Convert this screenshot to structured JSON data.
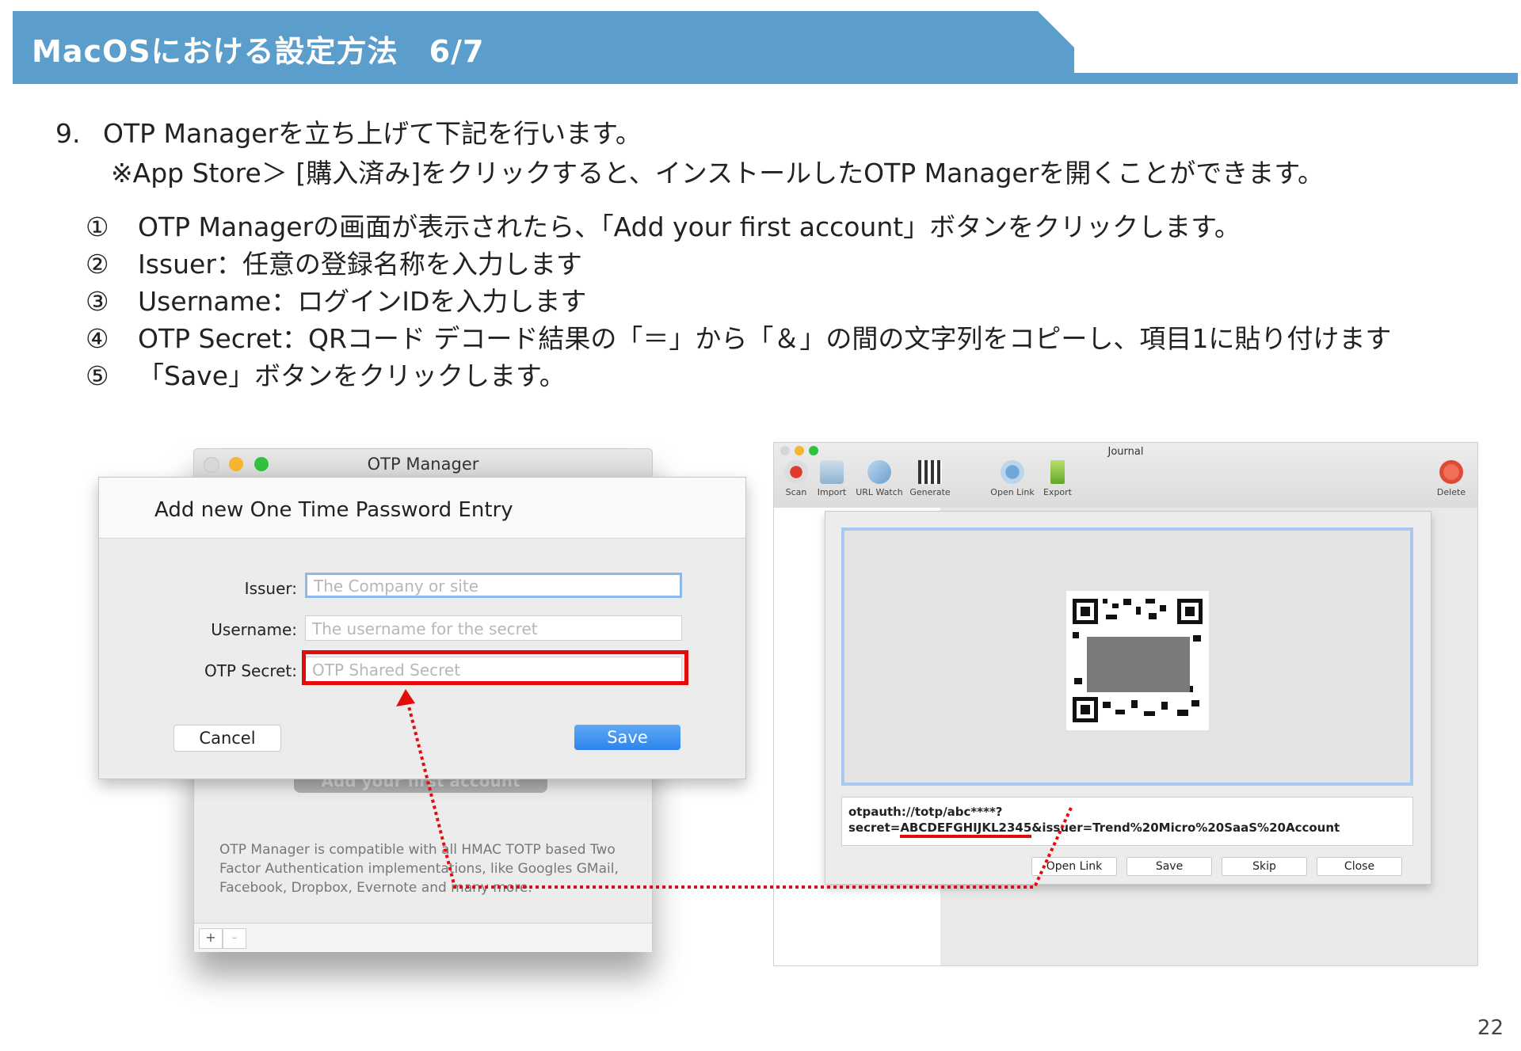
{
  "header": {
    "title": "MacOSにおける設定方法　6/7"
  },
  "intro": {
    "step_number": "9.",
    "step_text": "OTP Managerを立ち上げて下記を行います。",
    "note": "※App Store＞ [購入済み]をクリックすると、インストールしたOTP Managerを開くことができます。"
  },
  "instructions": [
    {
      "mark": "①",
      "text": "OTP Managerの画面が表示されたら、「Add your first account」ボタンをクリックします。"
    },
    {
      "mark": "②",
      "text": "Issuer：任意の登録名称を入力します"
    },
    {
      "mark": "③",
      "text": "Username：ログインIDを入力します"
    },
    {
      "mark": "④",
      "text": "OTP Secret：QRコード デコード結果の「＝」から「＆」の間の文字列をコピーし、項目1に貼り付けます"
    },
    {
      "mark": "⑤",
      "text": "「Save」ボタンをクリックします。"
    }
  ],
  "otp_window": {
    "title": "OTP Manager",
    "ghost_button": "Add your first account",
    "description": "OTP Manager is compatible with all HMAC TOTP based Two Factor Authentication implementations, like Googles GMail, Facebook, Dropbox, Evernote and many more.",
    "add_label": "+",
    "remove_label": "-"
  },
  "dialog": {
    "title": "Add new One Time Password Entry",
    "issuer_label": "Issuer:",
    "issuer_placeholder": "The Company or site",
    "username_label": "Username:",
    "username_placeholder": "The username for the secret",
    "secret_label": "OTP Secret:",
    "secret_placeholder": "OTP Shared Secret",
    "cancel": "Cancel",
    "save": "Save"
  },
  "journal": {
    "title": "Journal",
    "toolbar": [
      "Scan",
      "Import",
      "URL Watch",
      "Generate",
      "Open Link",
      "Export",
      "Delete"
    ],
    "url_prefix": "otpauth://totp/abc****?secret=",
    "url_secret": "ABCDEFGHIJKL2345",
    "url_suffix": "&issuer=Trend%20Micro%20SaaS%20Account",
    "buttons": [
      "Open Link",
      "Save",
      "Skip",
      "Close"
    ]
  },
  "colors": {
    "banner": "#5b9dcb",
    "highlight": "#e50b0b",
    "save_button": "#2d84ee"
  },
  "page_number": "22"
}
